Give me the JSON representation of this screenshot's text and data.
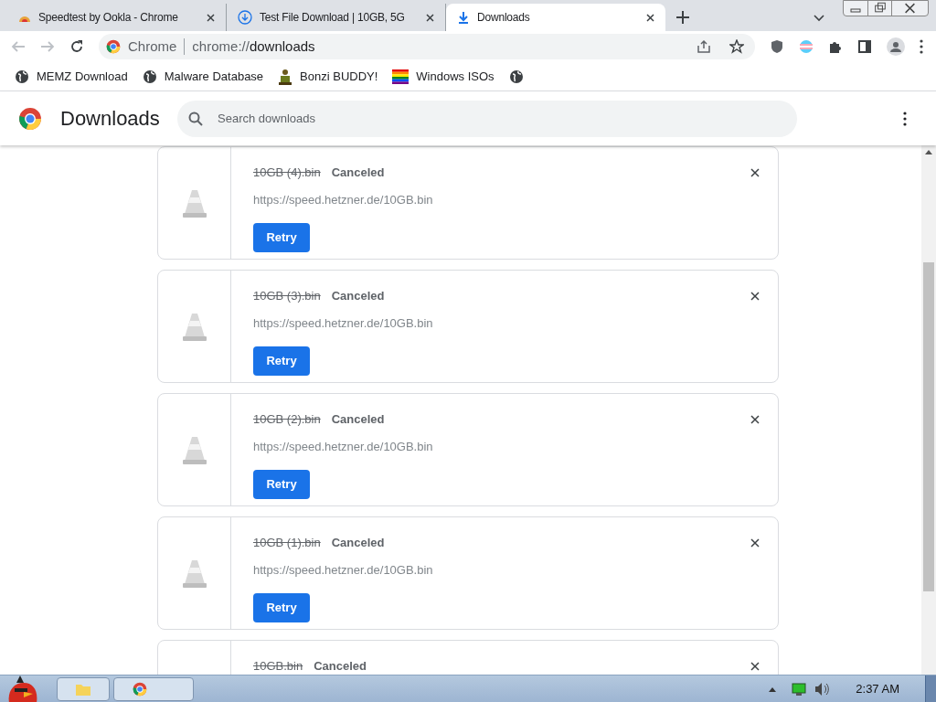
{
  "tabs": [
    {
      "title": "Speedtest by Ookla - Chrome",
      "selected": false
    },
    {
      "title": "Test File Download | 10GB, 5G",
      "selected": false
    },
    {
      "title": "Downloads",
      "selected": true
    }
  ],
  "address_bar": {
    "site": "Chrome",
    "url_prefix": "chrome://",
    "url_path": "downloads"
  },
  "bookmarks": [
    {
      "label": "MEMZ Download",
      "kind": "globe"
    },
    {
      "label": "Malware Database",
      "kind": "globe"
    },
    {
      "label": "Bonzi BUDDY!",
      "kind": "figure"
    },
    {
      "label": "Windows ISOs",
      "kind": "flag"
    },
    {
      "kind": "globe"
    }
  ],
  "page": {
    "title": "Downloads",
    "search": {
      "placeholder": "Search downloads"
    }
  },
  "downloads": [
    {
      "file": "10GB (4).bin",
      "status": "Canceled",
      "url": "https://speed.hetzner.de/10GB.bin",
      "button": "Retry"
    },
    {
      "file": "10GB (3).bin",
      "status": "Canceled",
      "url": "https://speed.hetzner.de/10GB.bin",
      "button": "Retry"
    },
    {
      "file": "10GB (2).bin",
      "status": "Canceled",
      "url": "https://speed.hetzner.de/10GB.bin",
      "button": "Retry"
    },
    {
      "file": "10GB (1).bin",
      "status": "Canceled",
      "url": "https://speed.hetzner.de/10GB.bin",
      "button": "Retry"
    },
    {
      "file": "10GB.bin",
      "status": "Canceled"
    }
  ],
  "taskbar": {
    "clock": "2:37 AM"
  }
}
